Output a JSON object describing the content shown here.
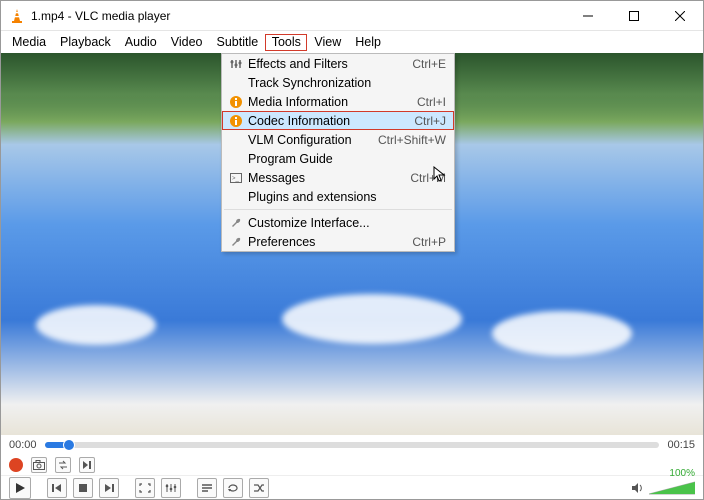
{
  "titlebar": {
    "title": "1.mp4 - VLC media player"
  },
  "menubar": {
    "items": [
      {
        "label": "Media"
      },
      {
        "label": "Playback"
      },
      {
        "label": "Audio"
      },
      {
        "label": "Video"
      },
      {
        "label": "Subtitle"
      },
      {
        "label": "Tools",
        "open": true
      },
      {
        "label": "View"
      },
      {
        "label": "Help"
      }
    ]
  },
  "tools_menu": {
    "items": [
      {
        "icon": "sliders",
        "label": "Effects and Filters",
        "shortcut": "Ctrl+E"
      },
      {
        "icon": "",
        "label": "Track Synchronization",
        "shortcut": ""
      },
      {
        "icon": "info",
        "label": "Media Information",
        "shortcut": "Ctrl+I"
      },
      {
        "icon": "info",
        "label": "Codec Information",
        "shortcut": "Ctrl+J",
        "highlighted": true
      },
      {
        "icon": "",
        "label": "VLM Configuration",
        "shortcut": "Ctrl+Shift+W"
      },
      {
        "icon": "",
        "label": "Program Guide",
        "shortcut": ""
      },
      {
        "icon": "console",
        "label": "Messages",
        "shortcut": "Ctrl+M"
      },
      {
        "icon": "",
        "label": "Plugins and extensions",
        "shortcut": ""
      },
      {
        "sep": true
      },
      {
        "icon": "wrench",
        "label": "Customize Interface...",
        "shortcut": ""
      },
      {
        "icon": "wrench",
        "label": "Preferences",
        "shortcut": "Ctrl+P"
      }
    ]
  },
  "playback": {
    "elapsed": "00:00",
    "total": "00:15",
    "progress_percent": 4
  },
  "volume": {
    "label": "100%",
    "level_percent": 100
  }
}
